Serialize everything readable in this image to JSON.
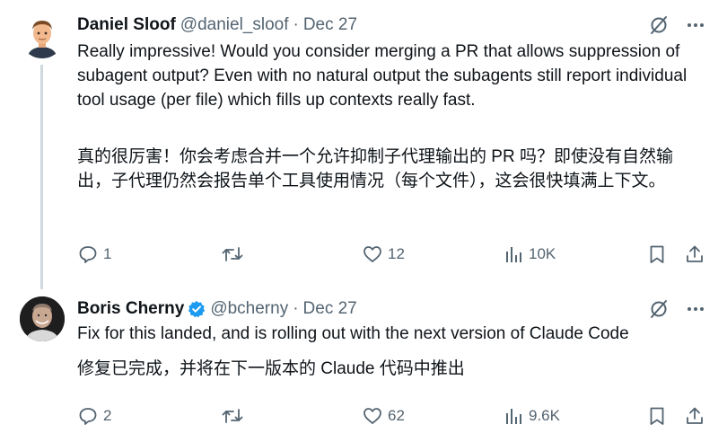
{
  "tweets": [
    {
      "author": {
        "name": "Daniel Sloof",
        "handle": "@daniel_sloof",
        "verified": false
      },
      "separator": "·",
      "date": "Dec 27",
      "text_en": "Really impressive! Would you consider merging a PR that allows suppression of subagent output? Even with no natural output the subagents still report individual tool usage (per file) which fills up contexts really fast.",
      "text_zh": "真的很厉害！你会考虑合并一个允许抑制子代理输出的 PR 吗？即使没有自然输出，子代理仍然会报告单个工具使用情况（每个文件），这会很快填满上下文。",
      "stats": {
        "replies": "1",
        "retweets": "",
        "likes": "12",
        "views": "10K"
      }
    },
    {
      "author": {
        "name": "Boris Cherny",
        "handle": "@bcherny",
        "verified": true
      },
      "separator": "·",
      "date": "Dec 27",
      "text_en": "Fix for this landed, and is rolling out with the next version of Claude Code",
      "text_zh": "修复已完成，并将在下一版本的 Claude 代码中推出",
      "stats": {
        "replies": "2",
        "retweets": "",
        "likes": "62",
        "views": "9.6K"
      }
    }
  ],
  "colors": {
    "text": "#0f1419",
    "muted": "#536471",
    "verified": "#1d9bf0",
    "thread_line": "#cfd9de"
  },
  "icons": [
    "grok-icon",
    "more-icon",
    "reply-icon",
    "retweet-icon",
    "like-icon",
    "views-icon",
    "bookmark-icon",
    "share-icon",
    "verified-icon"
  ]
}
